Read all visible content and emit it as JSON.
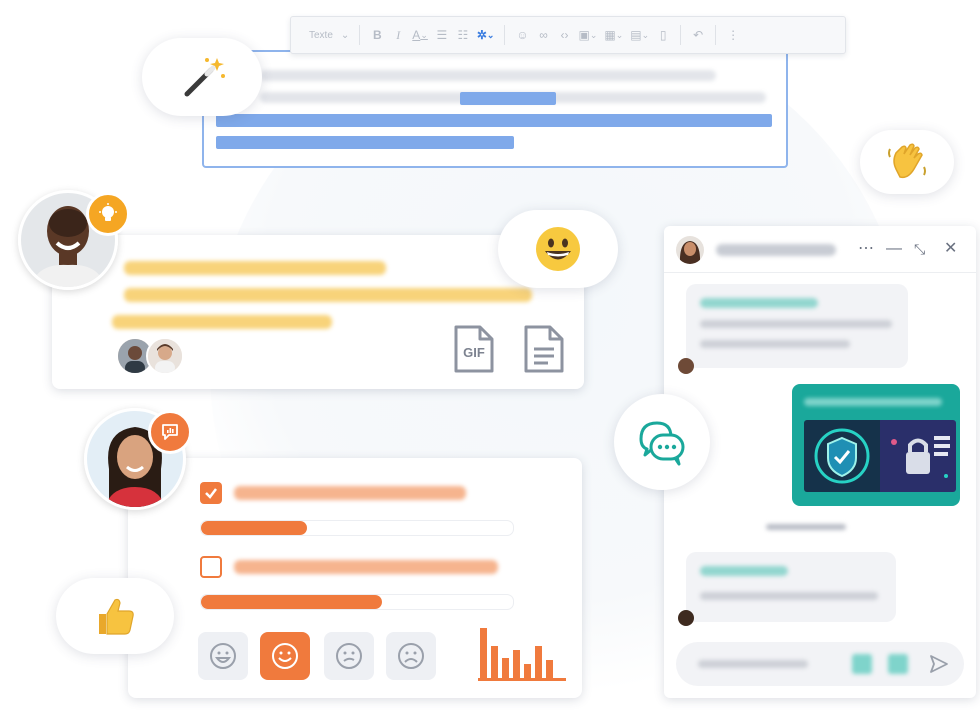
{
  "toolbar": {
    "style_label": "Texte",
    "icons": [
      "chevron-down-icon",
      "bold-icon",
      "italic-icon",
      "text-color-icon",
      "bullet-list-icon",
      "numbered-list-icon",
      "snippet-icon",
      "emoji-icon",
      "link-icon",
      "code-icon",
      "image-icon",
      "table-icon",
      "embed-icon",
      "file-icon",
      "undo-icon",
      "more-vertical-icon"
    ]
  },
  "pills": {
    "magic": "magic-wand-icon",
    "wave": "waving-hand-icon",
    "smile": "grinning-face-icon",
    "chat": "chat-bubbles-icon",
    "thumbs": "thumbs-up-icon"
  },
  "attachments": {
    "gif_label": "GIF"
  },
  "survey": {
    "progress_1": 0.34,
    "progress_2": 0.58,
    "selected_reaction": "happy",
    "reactions": [
      "grin-icon",
      "smile-icon",
      "confused-icon",
      "sad-icon"
    ]
  },
  "colors": {
    "accent_blue": "#3b7de0",
    "highlight_yellow": "#f6c94a",
    "survey_orange": "#f07a3d",
    "chat_teal": "#1aa89b",
    "badge_orange": "#f5a623"
  }
}
